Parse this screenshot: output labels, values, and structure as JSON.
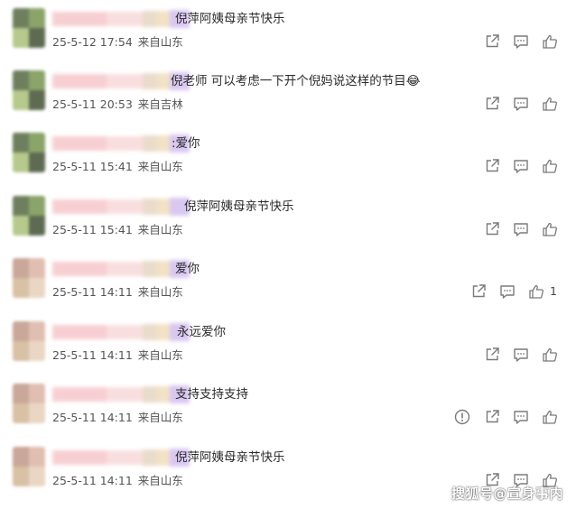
{
  "comments": [
    {
      "text": "倪萍阿姨母亲节快乐",
      "date": "25-5-12 17:54",
      "location": "来自山东",
      "like_count": "",
      "has_report": false,
      "avatar": "green"
    },
    {
      "text": "倪老师 可以考虑一下开个倪妈说这样的节目😂",
      "date": "25-5-11 20:53",
      "location": "来自吉林",
      "like_count": "",
      "has_report": false,
      "avatar": "green"
    },
    {
      "text": ":爱你",
      "date": "25-5-11 15:41",
      "location": "来自山东",
      "like_count": "",
      "has_report": false,
      "avatar": "green"
    },
    {
      "text": "倪萍阿姨母亲节快乐",
      "date": "25-5-11 15:41",
      "location": "来自山东",
      "like_count": "",
      "has_report": false,
      "avatar": "green"
    },
    {
      "text": "爱你",
      "date": "25-5-11 14:11",
      "location": "来自山东",
      "like_count": "1",
      "has_report": false,
      "avatar": "skin"
    },
    {
      "text": "永远爱你",
      "date": "25-5-11 14:11",
      "location": "来自山东",
      "like_count": "",
      "has_report": false,
      "avatar": "skin"
    },
    {
      "text": "支持支持支持",
      "date": "25-5-11 14:11",
      "location": "来自山东",
      "like_count": "",
      "has_report": true,
      "avatar": "skin"
    },
    {
      "text": "倪萍阿姨母亲节快乐",
      "date": "25-5-11 14:11",
      "location": "来自山东",
      "like_count": "",
      "has_report": false,
      "avatar": "skin"
    }
  ],
  "icons": {
    "share": "share-icon",
    "comment": "comment-icon",
    "like": "thumbs-up-icon",
    "report": "report-icon"
  },
  "colors": {
    "icon": "#7a7a7a",
    "text": "#2b2b2b",
    "meta": "#555555"
  },
  "watermark": "搜狐号@宣身事内"
}
